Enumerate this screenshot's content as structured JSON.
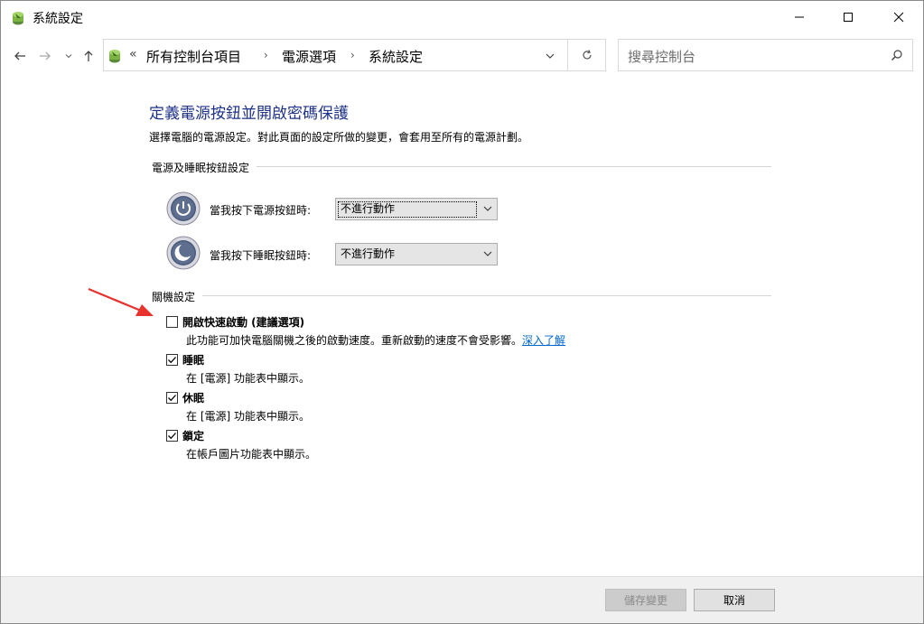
{
  "window": {
    "title": "系統設定"
  },
  "nav": {
    "chevrons": "«",
    "breadcrumbs": [
      "所有控制台項目",
      "電源選項",
      "系統設定"
    ],
    "separator": "›",
    "search_placeholder": "搜尋控制台"
  },
  "page": {
    "title": "定義電源按鈕並開啟密碼保護",
    "description": "選擇電腦的電源設定。對此頁面的設定所做的變更，會套用至所有的電源計劃。"
  },
  "power_section": {
    "heading": "電源及睡眠按鈕設定",
    "rows": [
      {
        "label": "當我按下電源按鈕時:",
        "value": "不進行動作"
      },
      {
        "label": "當我按下睡眠按鈕時:",
        "value": "不進行動作"
      }
    ]
  },
  "shutdown_section": {
    "heading": "關機設定",
    "options": [
      {
        "label": "開啟快速啟動 (建議選項)",
        "checked": false,
        "desc": "此功能可加快電腦關機之後的啟動速度。重新啟動的速度不會受影響。",
        "link": "深入了解"
      },
      {
        "label": "睡眠",
        "checked": true,
        "desc": "在 [電源] 功能表中顯示。"
      },
      {
        "label": "休眠",
        "checked": true,
        "desc": "在 [電源] 功能表中顯示。"
      },
      {
        "label": "鎖定",
        "checked": true,
        "desc": "在帳戶圖片功能表中顯示。"
      }
    ]
  },
  "footer": {
    "save_label": "儲存變更",
    "cancel_label": "取消"
  },
  "colors": {
    "title_blue": "#1e3287",
    "link_blue": "#0066cc",
    "annotation_arrow": "#e8322d"
  },
  "icons": {
    "app": "control-panel-icon",
    "power": "power-button-icon",
    "sleep": "sleep-button-icon",
    "refresh": "refresh-icon",
    "search": "search-icon"
  }
}
